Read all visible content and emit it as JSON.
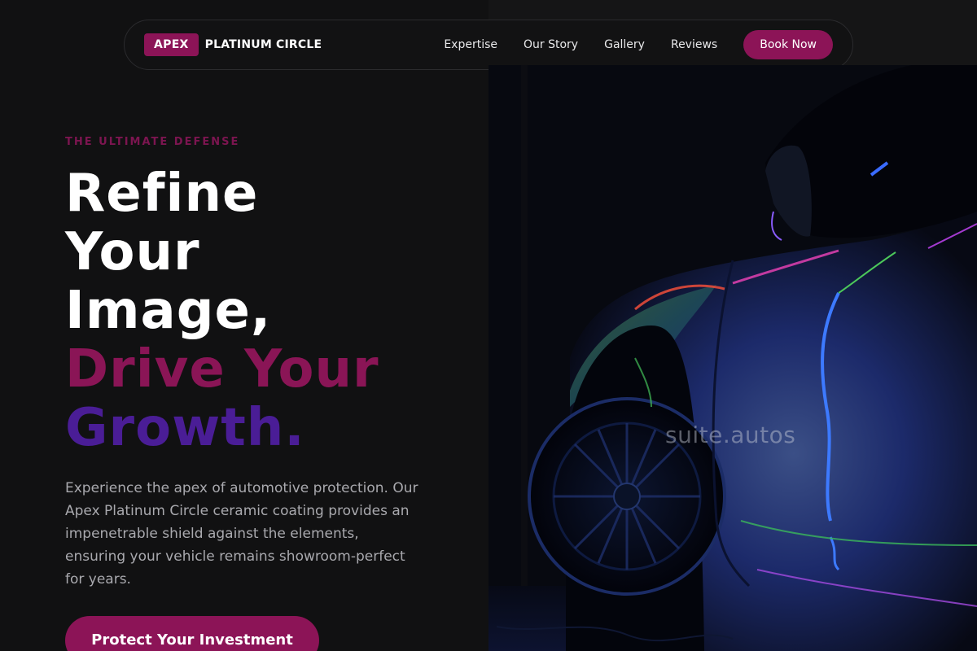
{
  "navbar": {
    "brand_badge": "APEX",
    "brand_name": "PLATINUM CIRCLE",
    "links": [
      {
        "label": "Expertise"
      },
      {
        "label": "Our Story"
      },
      {
        "label": "Gallery"
      },
      {
        "label": "Reviews"
      }
    ],
    "cta_label": "Book Now"
  },
  "hero": {
    "eyebrow": "THE ULTIMATE DEFENSE",
    "headline": {
      "line1": "Refine",
      "line2": "Your",
      "line3": "Image,",
      "line4": "Drive Your",
      "line5": "Growth."
    },
    "description": "Experience the apex of automotive protection. Our Apex Platinum Circle ceramic coating provides an impenetrable shield against the elements, ensuring your vehicle remains showroom-perfect for years.",
    "cta_label": "Protect Your Investment",
    "image_watermark": "suite.autos"
  },
  "colors": {
    "background": "#111112",
    "brand_accent": "#8c1457",
    "headline_accent_magenta": "#8a1556",
    "headline_accent_purple": "#4a1d96",
    "body_text": "#a9a9ae"
  }
}
